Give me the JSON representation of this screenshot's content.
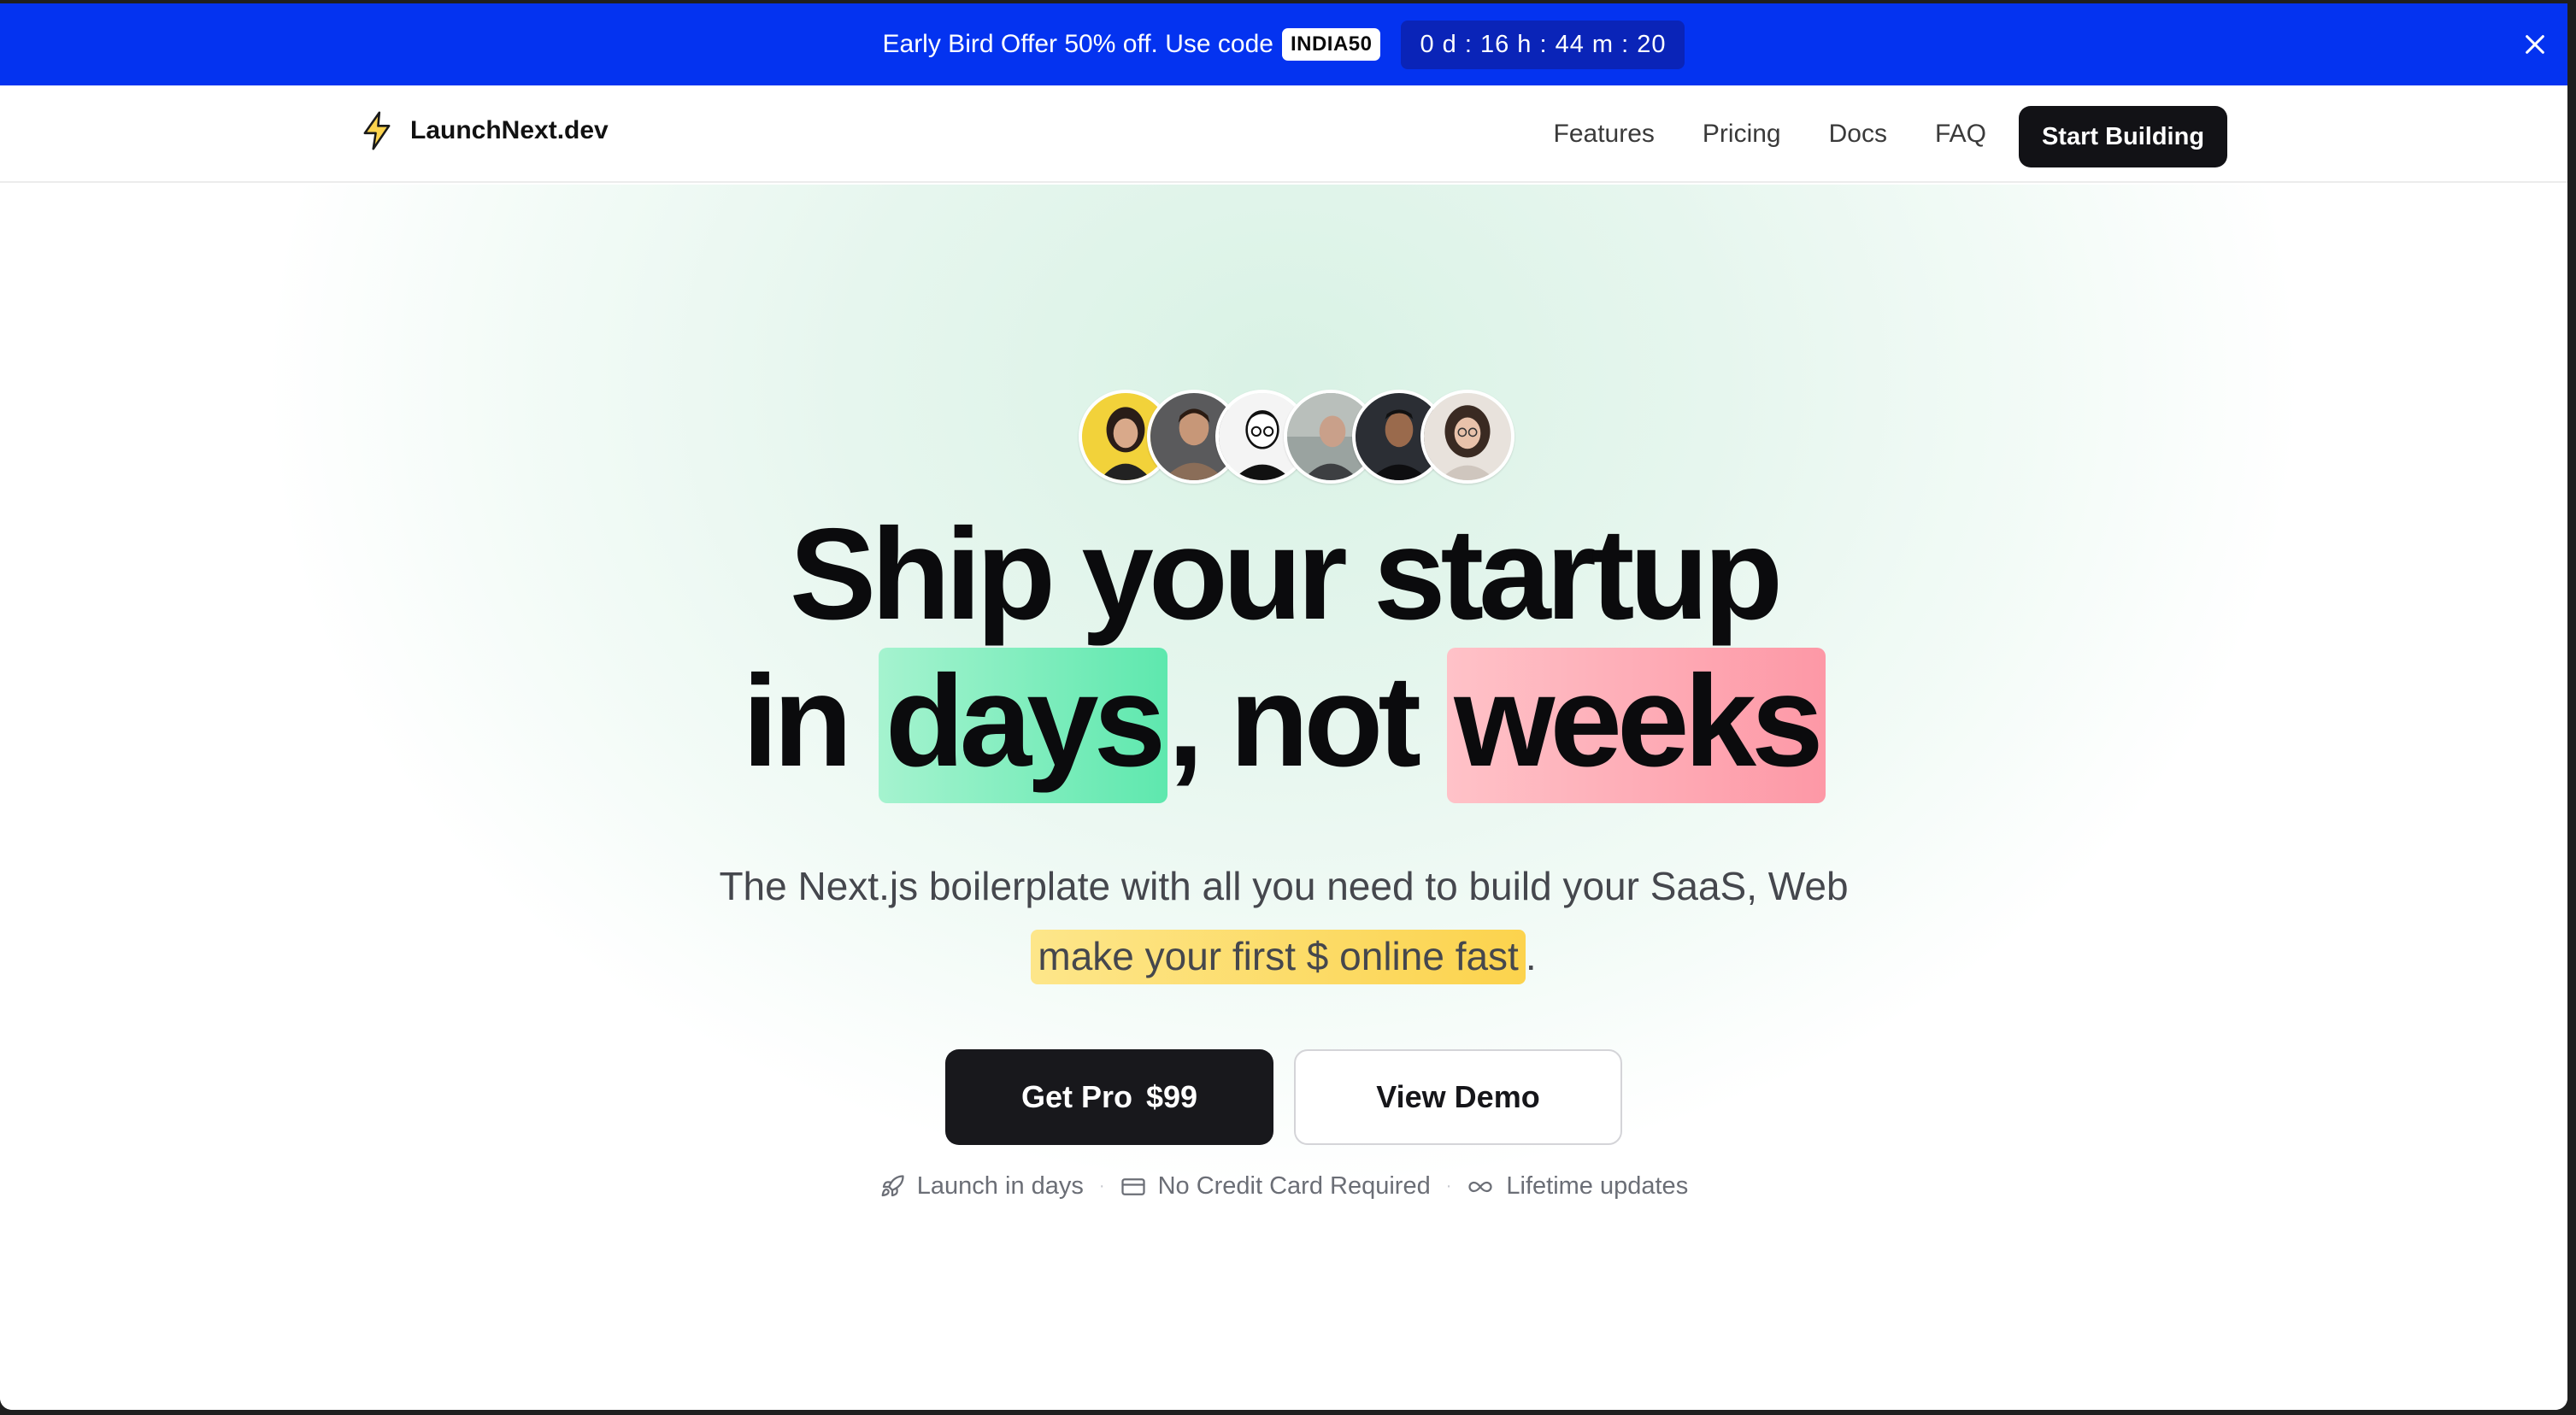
{
  "promo": {
    "text": "Early Bird Offer 50% off. Use code",
    "code": "INDIA50",
    "countdown": "0 d : 16 h : 44 m : 20"
  },
  "nav": {
    "brand": "LaunchNext.dev",
    "links": [
      "Features",
      "Pricing",
      "Docs",
      "FAQ"
    ],
    "cta": "Start Building"
  },
  "hero": {
    "headline_line1": "Ship your startup",
    "headline_in": "in",
    "headline_days": "days",
    "headline_comma_not": ", not",
    "headline_weeks": "weeks",
    "sub_line1": "The Next.js boilerplate with all you need to build your SaaS, Web",
    "sub_highlight": "make your first  $  online fast",
    "sub_period": ".",
    "primary_button_label": "Get Pro",
    "primary_button_price": "$99",
    "secondary_button": "View Demo",
    "features": [
      "Launch in days",
      "No Credit Card Required",
      "Lifetime updates"
    ],
    "separator": "·"
  },
  "colors": {
    "banner": "#0433f0",
    "highlight_green": "#5ee8ae",
    "highlight_red": "#fd98a6",
    "highlight_yellow": "#fcd34d",
    "primary_button": "#18181c"
  },
  "icons": [
    "bolt-icon",
    "close-icon",
    "rocket-icon",
    "credit-card-icon",
    "infinity-icon"
  ]
}
